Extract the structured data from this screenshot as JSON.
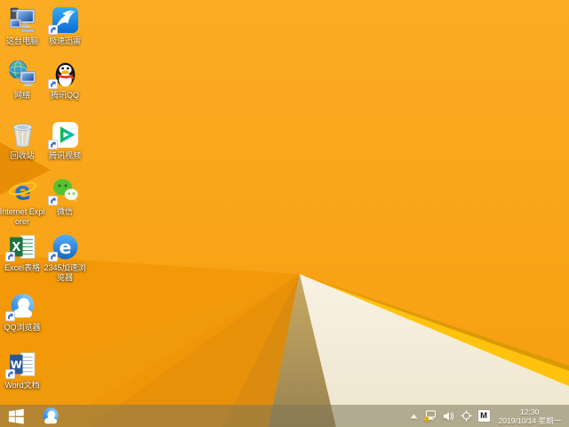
{
  "desktop": {
    "icons": [
      {
        "name": "this-pc",
        "label": "这台电脑"
      },
      {
        "name": "xunlei-speed",
        "label": "极速迅雷"
      },
      {
        "name": "network",
        "label": "网络"
      },
      {
        "name": "tencent-qq",
        "label": "腾讯QQ"
      },
      {
        "name": "recycle-bin",
        "label": "回收站"
      },
      {
        "name": "tencent-video",
        "label": "腾讯视频"
      },
      {
        "name": "internet-explorer",
        "label": "Internet Explorer"
      },
      {
        "name": "wechat",
        "label": "微信"
      },
      {
        "name": "excel-sheet",
        "label": "Excel表格"
      },
      {
        "name": "browser-2345",
        "label": "2345加速浏览器"
      },
      {
        "name": "qq-browser",
        "label": "QQ浏览器"
      },
      {
        "name": "word-doc",
        "label": "Word文档"
      }
    ]
  },
  "glyphs": {
    "ie": "e",
    "excel": "X",
    "word": "W",
    "browser2345": "e",
    "ime": "M"
  },
  "taskbar": {
    "pinned": [
      {
        "name": "qq-browser"
      }
    ],
    "tray": {
      "icon_names": [
        "show-hidden-icons",
        "network-limited",
        "volume",
        "safely-remove-hardware",
        "ime-indicator"
      ],
      "clock": {
        "time": "12:30",
        "date": "2019/10/14",
        "weekday": "星期一"
      }
    }
  },
  "wallpaper": {
    "theme": "windows-8.1-orange-folded-paper",
    "colors": {
      "base": "#F8A211",
      "fold_dark": "#DB8C0F",
      "tan": "#A68D52",
      "cream": "#F5EFDC",
      "fold_yellow": "#FFC30D"
    }
  }
}
